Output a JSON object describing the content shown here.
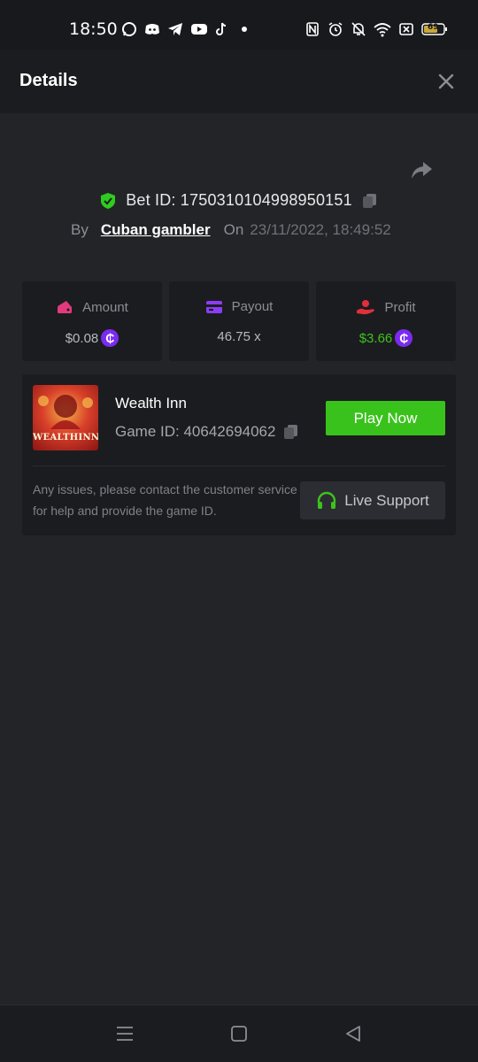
{
  "status_bar": {
    "time": "18:50",
    "app_icons": [
      "whatsapp-icon",
      "discord-icon",
      "telegram-icon",
      "youtube-icon",
      "tiktok-icon",
      "dot-icon"
    ],
    "system_icons": [
      "nfc-icon",
      "alarm-icon",
      "mute-icon",
      "wifi-icon",
      "close-box-icon",
      "battery-icon"
    ],
    "battery": "69"
  },
  "header": {
    "title": "Details"
  },
  "bet": {
    "label": "Bet ID: 1750310104998950151",
    "by_label": "By",
    "user": "Cuban gambler",
    "on_label": "On",
    "date": "23/11/2022, 18:49:52"
  },
  "stats": {
    "amount": {
      "label": "Amount",
      "value": "$0.08"
    },
    "payout": {
      "label": "Payout",
      "value": "46.75 x"
    },
    "profit": {
      "label": "Profit",
      "value": "$3.66"
    },
    "coin_symbol": "₵"
  },
  "game": {
    "thumb_text": "WEALTHINN",
    "name": "Wealth Inn",
    "id_label": "Game ID: 40642694062",
    "play_label": "Play Now",
    "issue_text": "Any issues, please contact the customer service for help and provide the game ID.",
    "support_label": "Live Support"
  },
  "colors": {
    "accent_green": "#3ac21c",
    "profit_green": "#3ec21e",
    "coin_purple": "#7b2bf0",
    "amount_pink": "#e23a7c",
    "payout_purple": "#8b3cf6",
    "profit_red": "#e0303a"
  }
}
